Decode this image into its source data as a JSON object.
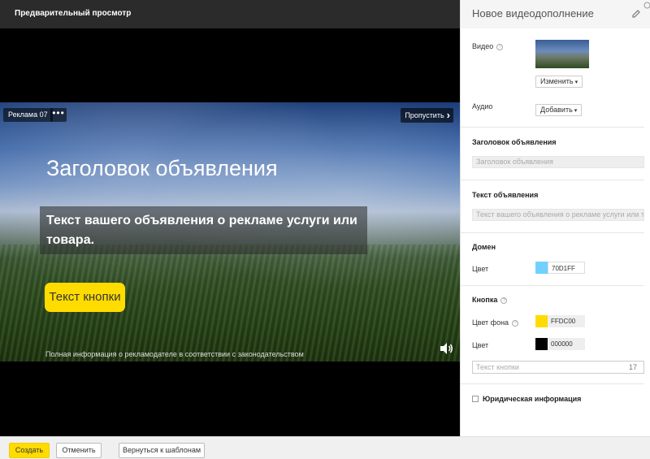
{
  "preview": {
    "title": "Предварительный просмотр",
    "ad_badge": "Реклама 07",
    "more": "•••",
    "skip": "Пропустить",
    "headline": "Заголовок объявления",
    "body_text": "Текст вашего объявления о рекламе услуги или товара.",
    "button_text": "Текст кнопки",
    "legal": "Полная информация о рекламодателе в соответствии с законодательством"
  },
  "panel": {
    "title": "Новое видеодополнение",
    "video_label": "Видео",
    "change_label": "Изменить",
    "audio_label": "Аудио",
    "add_label": "Добавить",
    "headline_section": "Заголовок объявления",
    "headline_placeholder": "Заголовок объявления",
    "text_section": "Текст объявления",
    "text_placeholder": "Текст вашего объявления о рекламе услуги или товара",
    "domain_section": "Домен",
    "domain_color_label": "Цвет",
    "domain_color_hex": "70D1FF",
    "button_section": "Кнопка",
    "bg_color_label": "Цвет фона",
    "bg_color_hex": "FFDC00",
    "text_color_label": "Цвет",
    "text_color_hex": "000000",
    "button_text_placeholder": "Текст кнопки",
    "button_text_counter": "17",
    "legal_info_label": "Юридическая информация"
  },
  "colors": {
    "domain": "#70D1FF",
    "button_bg": "#FFDC00",
    "button_text": "#000000"
  },
  "footer": {
    "create": "Создать",
    "cancel": "Отменить",
    "back": "Вернуться к шаблонам"
  },
  "icons": [
    "more-icon",
    "skip-arrow-icon",
    "sound-icon",
    "edit-icon",
    "help-icon",
    "caret-down-icon",
    "close-icon"
  ]
}
